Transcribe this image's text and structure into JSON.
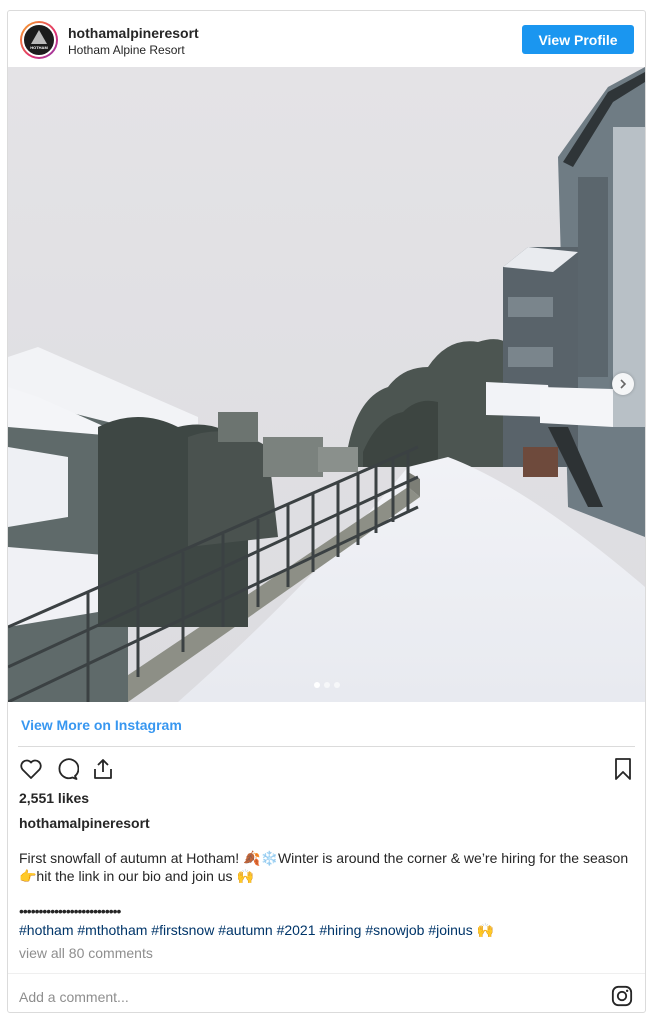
{
  "header": {
    "username": "hothamalpineresort",
    "full_name": "Hotham Alpine Resort",
    "avatar_text": "HOTHAM",
    "view_profile_label": "View Profile"
  },
  "photo": {
    "subject": "snow",
    "carousel": {
      "total": 3,
      "active_index": 0
    }
  },
  "view_more_label": "View More on Instagram",
  "actions": {
    "icons": [
      "heart-icon",
      "comment-icon",
      "share-icon",
      "bookmark-icon"
    ]
  },
  "likes": "2,551 likes",
  "caption": {
    "user": "hothamalpineresort",
    "text": "First snowfall of autumn at Hotham! 🍂❄️Winter is around the corner & we’re hiring for the season 👉hit the link in our bio and join us 🙌",
    "bullets": "••••••••••••••••••••••••••",
    "hashtags": "#hotham #mthotham #firstsnow #autumn #2021 #hiring #snowjob #joinus 🙌"
  },
  "comments_link": "view all 80 comments",
  "add_comment_placeholder": "Add a comment...",
  "colors": {
    "button_blue": "#1a96f0",
    "link_blue": "#3897f0",
    "hashtag_blue": "#003569",
    "muted_gray": "#8e8e8e"
  }
}
